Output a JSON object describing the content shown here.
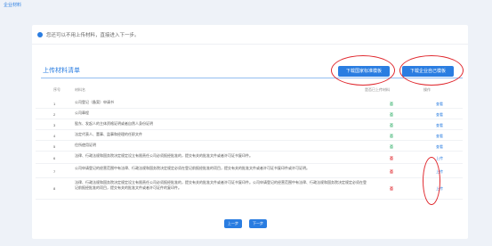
{
  "page_title": "企业材料",
  "notice": "您还可以不用上传材料，直接进入下一步。",
  "section_title": "上传材料清单",
  "buttons": {
    "add_empty": "下载国家标准模板",
    "add_doc": "下载企业自己模板"
  },
  "table": {
    "headers": [
      "序号",
      "材料名",
      "是否已上传材料",
      "操作"
    ],
    "rows": [
      {
        "no": "1",
        "name": "公司登记（备案）申请书",
        "status": "否",
        "status_color": "#3cb371",
        "op": "查看"
      },
      {
        "no": "2",
        "name": "公司章程",
        "status": "否",
        "status_color": "#3cb371",
        "op": "查看"
      },
      {
        "no": "3",
        "name": "股东、发起人的主体资格证明或者自然人身份证明",
        "status": "否",
        "status_color": "#3cb371",
        "op": "查看"
      },
      {
        "no": "4",
        "name": "法定代表人、董事、监事和经理的任职文件",
        "status": "否",
        "status_color": "#3cb371",
        "op": "查看"
      },
      {
        "no": "5",
        "name": "住所使用证明",
        "status": "否",
        "status_color": "#3cb371",
        "op": "查看"
      },
      {
        "no": "6",
        "name": "法律、行政法规和国务院决定规定设立有限责任公司必须报经批准的，提交有关的批准文件或者许可证书复印件。",
        "status": "否",
        "status_color": "#e0282e",
        "op": "上传"
      },
      {
        "no": "7",
        "name": "公司申请登记的经营范围中有法律、行政法规和国务院决定规定必须在登记前报经批准的项目，提交有关的批准文件或者许可证书复印件或许可证明。",
        "status": "否",
        "status_color": "#e0282e",
        "op": "上传"
      },
      {
        "no": "8",
        "name": "法律、行政法规和国务院决定规定设立有限责任公司必须报经批准的，提交有关的批准文件或者许可证书复印件。公司申请登记的经营范围中有法律、行政法规和国务院决定规定必须在登记前报经批准的项目，提交有关的批准文件或者许可证件的复印件。",
        "status": "否",
        "status_color": "#e0282e",
        "op": "上传"
      }
    ]
  },
  "pager": {
    "prev": "上一步",
    "next": "下一步"
  }
}
